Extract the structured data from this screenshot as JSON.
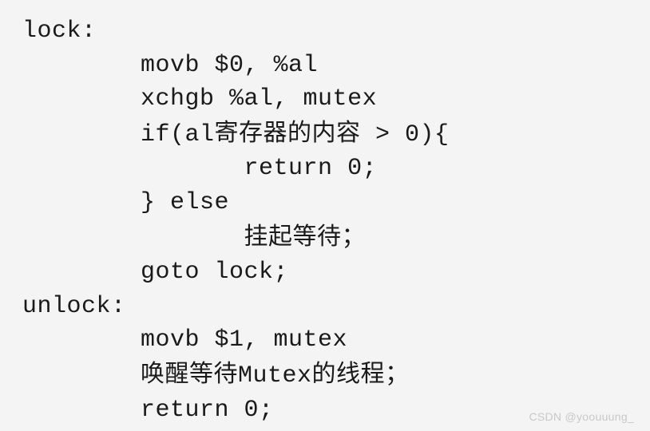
{
  "code": {
    "l1": "lock:",
    "l2": "        movb $0, %al",
    "l3": "        xchgb %al, mutex",
    "l4a": "        if(al",
    "l4b": "寄存器的内容",
    "l4c": " > 0){",
    "l5": "               return 0;",
    "l6": "        } else",
    "l7a": "               ",
    "l7b": "挂起等待；",
    "l8": "        goto lock;",
    "l9": "",
    "l10": "unlock:",
    "l11": "        movb $1, mutex",
    "l12a": "        ",
    "l12b": "唤醒等待",
    "l12c": "Mutex",
    "l12d": "的线程；",
    "l13": "        return 0;"
  },
  "watermark": "CSDN @yoouuung_"
}
